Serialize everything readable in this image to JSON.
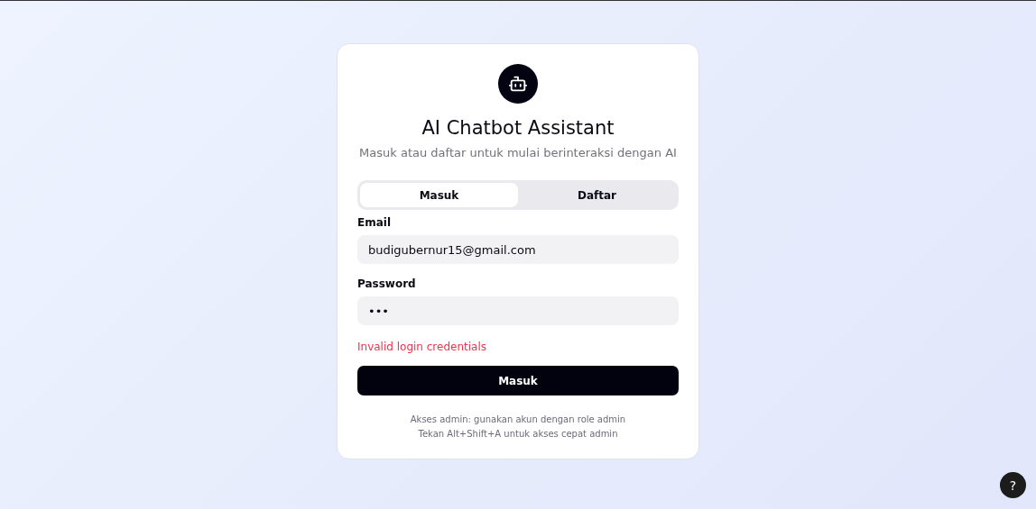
{
  "card": {
    "title": "AI Chatbot Assistant",
    "subtitle": "Masuk atau daftar untuk mulai berinteraksi dengan AI"
  },
  "tabs": [
    {
      "label": "Masuk",
      "selected": true
    },
    {
      "label": "Daftar",
      "selected": false
    }
  ],
  "fields": [
    {
      "label": "Email",
      "value": "budigubernur15@gmail.com"
    },
    {
      "label": "Password",
      "value": "•••"
    }
  ],
  "error": "Invalid login credentials",
  "submit_button": "Masuk",
  "notes": [
    "Akses admin: gunakan akun dengan role admin",
    "Tekan Alt+Shift+A untuk akses cepat admin"
  ],
  "help_button": "?"
}
